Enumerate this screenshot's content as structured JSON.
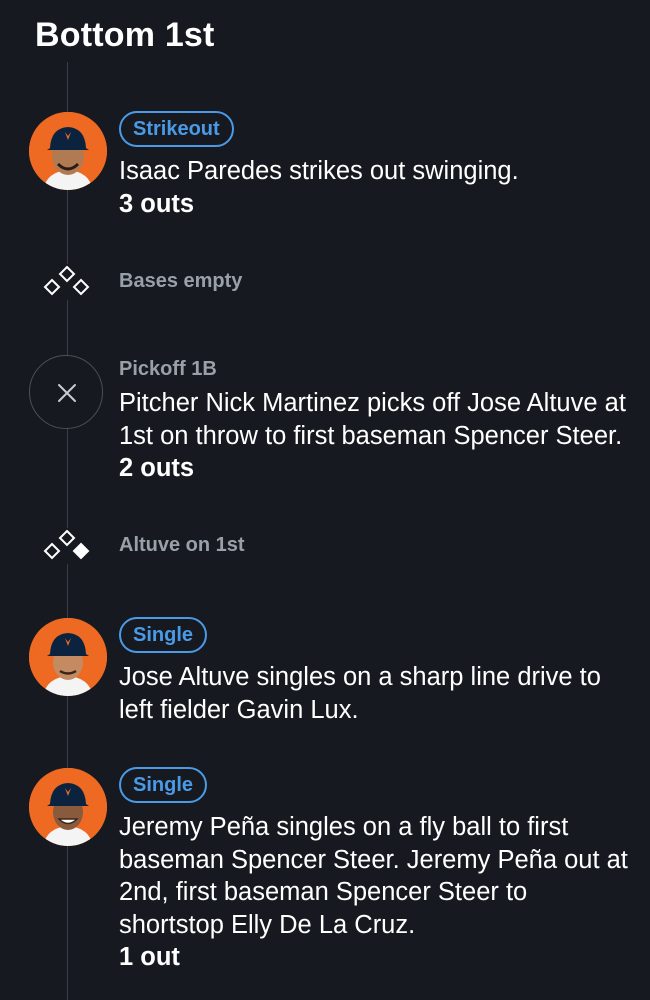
{
  "inning": {
    "title": "Bottom 1st"
  },
  "colors": {
    "background": "#161a20",
    "accent": "#4a9ae8",
    "muted": "#9aa0a8",
    "avatar_bg": "#ee6a22"
  },
  "events": [
    {
      "type": "play",
      "badge": "Strikeout",
      "avatar": "player-avatar",
      "text": "Isaac Paredes strikes out swinging.",
      "outs": "3 outs"
    },
    {
      "type": "bases",
      "icon": "bases-empty-icon",
      "label": "Bases empty"
    },
    {
      "type": "play",
      "label": "Pickoff 1B",
      "icon": "close-icon",
      "text": "Pitcher Nick Martinez picks off Jose Altuve at 1st on throw to first baseman Spencer Steer.",
      "outs": "2 outs"
    },
    {
      "type": "bases",
      "icon": "runner-on-first-icon",
      "label": "Altuve on 1st"
    },
    {
      "type": "play",
      "badge": "Single",
      "avatar": "player-avatar",
      "text": "Jose Altuve singles on a sharp line drive to left fielder Gavin Lux."
    },
    {
      "type": "play",
      "badge": "Single",
      "avatar": "player-avatar",
      "text": "Jeremy Peña singles on a fly ball to first baseman Spencer Steer. Jeremy Peña out at 2nd, first baseman Spencer Steer to shortstop Elly De La Cruz.",
      "outs": "1 out"
    }
  ]
}
